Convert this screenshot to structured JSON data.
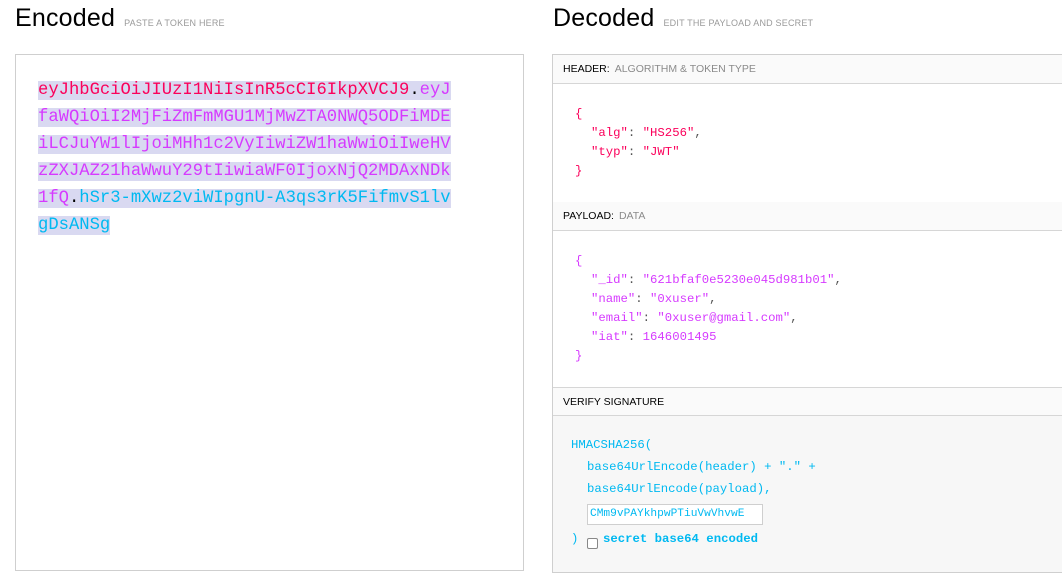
{
  "encoded": {
    "title": "Encoded",
    "subtitle": "PASTE A TOKEN HERE",
    "token": {
      "header": "eyJhbGciOiJIUzI1NiIsInR5cCI6IkpXVCJ9",
      "dot1": ".",
      "payload": "eyJfaWQiOiI2MjFiZmFmMGU1MjMwZTA0NWQ5ODFiMDEiLCJuYW1lIjoiMHh1c2VyIiwiZW1haWwiOiIweHVzZXJAZ21haWwuY29tIiwiaWF0IjoxNjQ2MDAxNDk1fQ",
      "dot2": ".",
      "signature": "hSr3-mXwz2viWIpgnU-A3qs3rK5FifmvS1lvgDsANSg"
    }
  },
  "decoded": {
    "title": "Decoded",
    "subtitle": "EDIT THE PAYLOAD AND SECRET",
    "header_section": {
      "label": "HEADER:",
      "sublabel": "ALGORITHM & TOKEN TYPE",
      "open": "{",
      "close": "}",
      "lines": [
        {
          "key": "\"alg\"",
          "value": "\"HS256\"",
          "comma": ","
        },
        {
          "key": "\"typ\"",
          "value": "\"JWT\"",
          "comma": ""
        }
      ]
    },
    "payload_section": {
      "label": "PAYLOAD:",
      "sublabel": "DATA",
      "open": "{",
      "close": "}",
      "lines": [
        {
          "key": "\"_id\"",
          "value": "\"621bfaf0e5230e045d981b01\"",
          "comma": ","
        },
        {
          "key": "\"name\"",
          "value": "\"0xuser\"",
          "comma": ","
        },
        {
          "key": "\"email\"",
          "value": "\"0xuser@gmail.com\"",
          "comma": ","
        },
        {
          "key": "\"iat\"",
          "value": "1646001495",
          "comma": ""
        }
      ]
    },
    "signature_section": {
      "label": "VERIFY SIGNATURE",
      "fn": "HMACSHA256(",
      "line1": "base64UrlEncode(header) + \".\" +",
      "line2": "base64UrlEncode(payload),",
      "secret_value": "CMm9vPAYkhpwPTiuVwVhvwE",
      "close": ")",
      "checkbox_label": "secret base64 encoded",
      "checkbox_checked": false
    }
  }
}
